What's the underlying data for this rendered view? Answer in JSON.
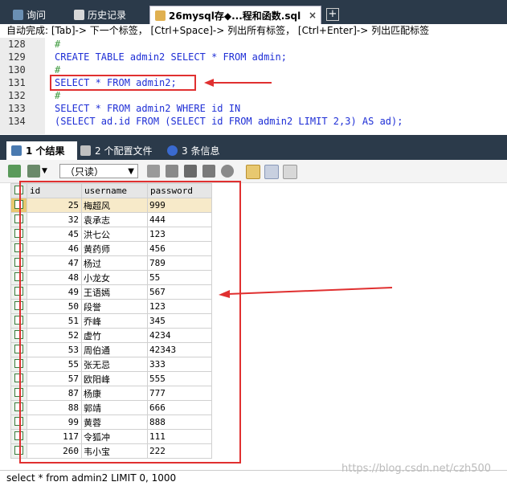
{
  "tabs": [
    {
      "label": "询问"
    },
    {
      "label": "历史记录"
    },
    {
      "label": "26mysql存◆...程和函数.sql",
      "close": "×"
    }
  ],
  "new_tab": "+",
  "hint": "自动完成:  [Tab]-> 下一个标签， [Ctrl+Space]-> 列出所有标签， [Ctrl+Enter]-> 列出匹配标签",
  "editor": {
    "lines": [
      {
        "num": "128",
        "code": "#"
      },
      {
        "num": "129",
        "code": "CREATE TABLE admin2 SELECT * FROM admin;"
      },
      {
        "num": "130",
        "code": "#"
      },
      {
        "num": "131",
        "code": "SELECT * FROM admin2;"
      },
      {
        "num": "132",
        "code": "#"
      },
      {
        "num": "133",
        "code": "SELECT * FROM admin2 WHERE id IN"
      },
      {
        "num": "134",
        "code": "(SELECT ad.id FROM (SELECT id FROM admin2 LIMIT 2,3) AS ad);"
      }
    ]
  },
  "result_tabs": [
    {
      "label": "1 个结果"
    },
    {
      "label": "2 个配置文件"
    },
    {
      "label": "3 条信息"
    }
  ],
  "toolbar": {
    "mode_select": "（只读）"
  },
  "grid": {
    "columns": [
      "id",
      "username",
      "password"
    ],
    "rows": [
      [
        "25",
        "梅超风",
        "999"
      ],
      [
        "32",
        "袁承志",
        "444"
      ],
      [
        "45",
        "洪七公",
        "123"
      ],
      [
        "46",
        "黄药师",
        "456"
      ],
      [
        "47",
        "杨过",
        "789"
      ],
      [
        "48",
        "小龙女",
        "55"
      ],
      [
        "49",
        "王语嫣",
        "567"
      ],
      [
        "50",
        "段誉",
        "123"
      ],
      [
        "51",
        "乔峰",
        "345"
      ],
      [
        "52",
        "虚竹",
        "4234"
      ],
      [
        "53",
        "周伯通",
        "42343"
      ],
      [
        "55",
        "张无忌",
        "333"
      ],
      [
        "57",
        "欧阳峰",
        "555"
      ],
      [
        "87",
        "杨康",
        "777"
      ],
      [
        "88",
        "郭靖",
        "666"
      ],
      [
        "99",
        "黄蓉",
        "888"
      ],
      [
        "117",
        "令狐冲",
        "111"
      ],
      [
        "260",
        "韦小宝",
        "222"
      ]
    ]
  },
  "status": "select * from admin2 LIMIT 0, 1000",
  "watermark": "https://blog.csdn.net/czh500",
  "colors": {
    "annotation": "#e03030",
    "keyword": "#1f2fd6",
    "comment": "#3d9a3d"
  }
}
